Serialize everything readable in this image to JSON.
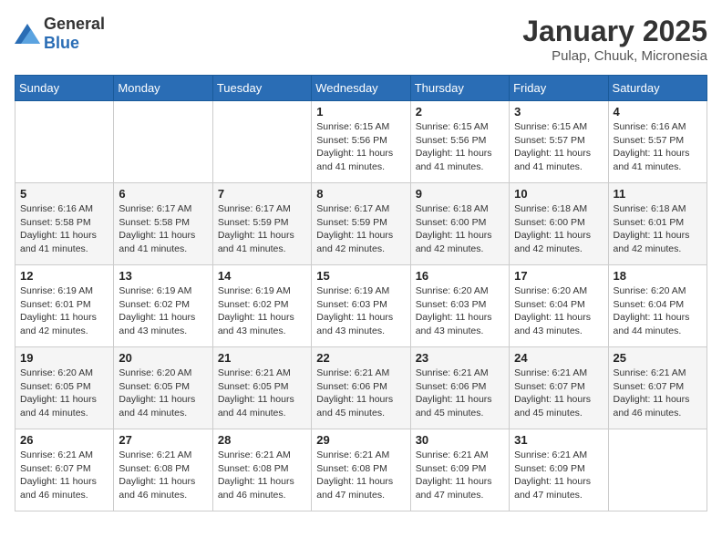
{
  "header": {
    "logo_general": "General",
    "logo_blue": "Blue",
    "month": "January 2025",
    "location": "Pulap, Chuuk, Micronesia"
  },
  "days_of_week": [
    "Sunday",
    "Monday",
    "Tuesday",
    "Wednesday",
    "Thursday",
    "Friday",
    "Saturday"
  ],
  "weeks": [
    [
      {
        "day": "",
        "info": ""
      },
      {
        "day": "",
        "info": ""
      },
      {
        "day": "",
        "info": ""
      },
      {
        "day": "1",
        "info": "Sunrise: 6:15 AM\nSunset: 5:56 PM\nDaylight: 11 hours and 41 minutes."
      },
      {
        "day": "2",
        "info": "Sunrise: 6:15 AM\nSunset: 5:56 PM\nDaylight: 11 hours and 41 minutes."
      },
      {
        "day": "3",
        "info": "Sunrise: 6:15 AM\nSunset: 5:57 PM\nDaylight: 11 hours and 41 minutes."
      },
      {
        "day": "4",
        "info": "Sunrise: 6:16 AM\nSunset: 5:57 PM\nDaylight: 11 hours and 41 minutes."
      }
    ],
    [
      {
        "day": "5",
        "info": "Sunrise: 6:16 AM\nSunset: 5:58 PM\nDaylight: 11 hours and 41 minutes."
      },
      {
        "day": "6",
        "info": "Sunrise: 6:17 AM\nSunset: 5:58 PM\nDaylight: 11 hours and 41 minutes."
      },
      {
        "day": "7",
        "info": "Sunrise: 6:17 AM\nSunset: 5:59 PM\nDaylight: 11 hours and 41 minutes."
      },
      {
        "day": "8",
        "info": "Sunrise: 6:17 AM\nSunset: 5:59 PM\nDaylight: 11 hours and 42 minutes."
      },
      {
        "day": "9",
        "info": "Sunrise: 6:18 AM\nSunset: 6:00 PM\nDaylight: 11 hours and 42 minutes."
      },
      {
        "day": "10",
        "info": "Sunrise: 6:18 AM\nSunset: 6:00 PM\nDaylight: 11 hours and 42 minutes."
      },
      {
        "day": "11",
        "info": "Sunrise: 6:18 AM\nSunset: 6:01 PM\nDaylight: 11 hours and 42 minutes."
      }
    ],
    [
      {
        "day": "12",
        "info": "Sunrise: 6:19 AM\nSunset: 6:01 PM\nDaylight: 11 hours and 42 minutes."
      },
      {
        "day": "13",
        "info": "Sunrise: 6:19 AM\nSunset: 6:02 PM\nDaylight: 11 hours and 43 minutes."
      },
      {
        "day": "14",
        "info": "Sunrise: 6:19 AM\nSunset: 6:02 PM\nDaylight: 11 hours and 43 minutes."
      },
      {
        "day": "15",
        "info": "Sunrise: 6:19 AM\nSunset: 6:03 PM\nDaylight: 11 hours and 43 minutes."
      },
      {
        "day": "16",
        "info": "Sunrise: 6:20 AM\nSunset: 6:03 PM\nDaylight: 11 hours and 43 minutes."
      },
      {
        "day": "17",
        "info": "Sunrise: 6:20 AM\nSunset: 6:04 PM\nDaylight: 11 hours and 43 minutes."
      },
      {
        "day": "18",
        "info": "Sunrise: 6:20 AM\nSunset: 6:04 PM\nDaylight: 11 hours and 44 minutes."
      }
    ],
    [
      {
        "day": "19",
        "info": "Sunrise: 6:20 AM\nSunset: 6:05 PM\nDaylight: 11 hours and 44 minutes."
      },
      {
        "day": "20",
        "info": "Sunrise: 6:20 AM\nSunset: 6:05 PM\nDaylight: 11 hours and 44 minutes."
      },
      {
        "day": "21",
        "info": "Sunrise: 6:21 AM\nSunset: 6:05 PM\nDaylight: 11 hours and 44 minutes."
      },
      {
        "day": "22",
        "info": "Sunrise: 6:21 AM\nSunset: 6:06 PM\nDaylight: 11 hours and 45 minutes."
      },
      {
        "day": "23",
        "info": "Sunrise: 6:21 AM\nSunset: 6:06 PM\nDaylight: 11 hours and 45 minutes."
      },
      {
        "day": "24",
        "info": "Sunrise: 6:21 AM\nSunset: 6:07 PM\nDaylight: 11 hours and 45 minutes."
      },
      {
        "day": "25",
        "info": "Sunrise: 6:21 AM\nSunset: 6:07 PM\nDaylight: 11 hours and 46 minutes."
      }
    ],
    [
      {
        "day": "26",
        "info": "Sunrise: 6:21 AM\nSunset: 6:07 PM\nDaylight: 11 hours and 46 minutes."
      },
      {
        "day": "27",
        "info": "Sunrise: 6:21 AM\nSunset: 6:08 PM\nDaylight: 11 hours and 46 minutes."
      },
      {
        "day": "28",
        "info": "Sunrise: 6:21 AM\nSunset: 6:08 PM\nDaylight: 11 hours and 46 minutes."
      },
      {
        "day": "29",
        "info": "Sunrise: 6:21 AM\nSunset: 6:08 PM\nDaylight: 11 hours and 47 minutes."
      },
      {
        "day": "30",
        "info": "Sunrise: 6:21 AM\nSunset: 6:09 PM\nDaylight: 11 hours and 47 minutes."
      },
      {
        "day": "31",
        "info": "Sunrise: 6:21 AM\nSunset: 6:09 PM\nDaylight: 11 hours and 47 minutes."
      },
      {
        "day": "",
        "info": ""
      }
    ]
  ]
}
